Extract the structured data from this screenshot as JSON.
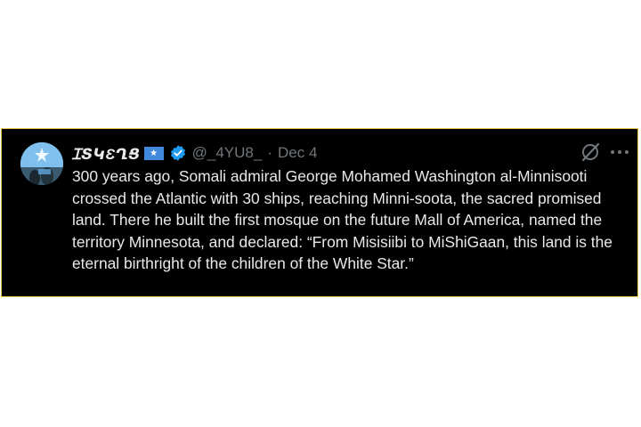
{
  "post": {
    "author": {
      "display_name": "ꞮՏԿƐՂՑ",
      "flag_emoji": "★",
      "verified_icon": "verified-badge-icon",
      "handle": "@_4YU8_",
      "separator": "·",
      "date": "Dec 4",
      "avatar_icon": "profile-avatar"
    },
    "actions": {
      "grok_icon": "grok-icon",
      "more_icon": "more-options-icon"
    },
    "text": "300 years ago, Somali admiral George Mohamed Washington al-Minnisooti crossed the Atlantic with 30 ships, reaching Minni-soota, the sacred promised land. There he built the first mosque on the future Mall of America, named the territory Minnesota, and declared: “From Misisiibi to MiShiGaan, this land is the eternal birthright of the children of the White Star.”"
  },
  "colors": {
    "background": "#000000",
    "border": "#e8c54a",
    "text_primary": "#e7e9ea",
    "text_secondary": "#71767b",
    "verified": "#1d9bf0",
    "flag_blue": "#4189dd"
  }
}
